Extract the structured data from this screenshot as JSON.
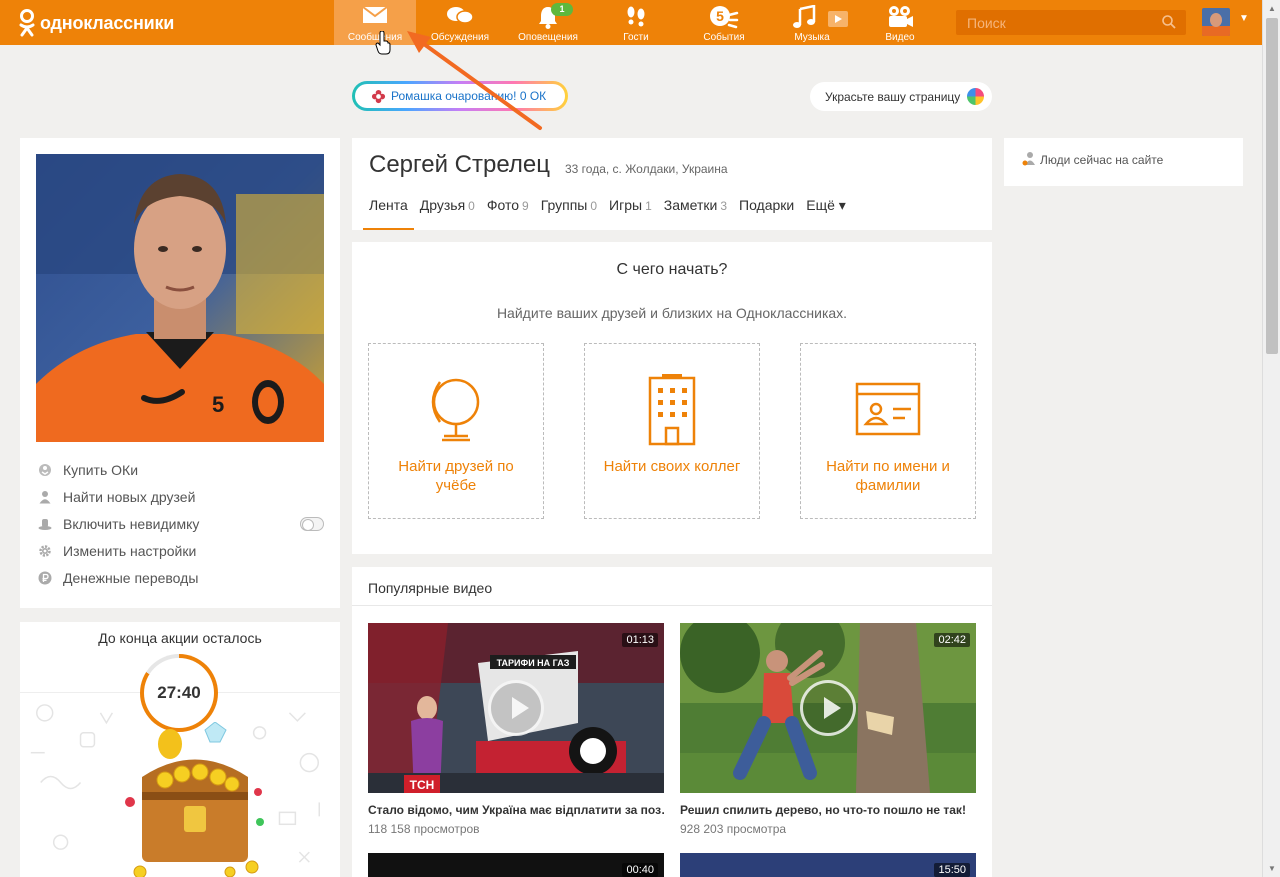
{
  "app": {
    "logo_text": "одноклассники",
    "brand_color": "#ee8208"
  },
  "nav": [
    {
      "label": "Сообщения",
      "icon": "envelope-icon",
      "badge": ""
    },
    {
      "label": "Обсуждения",
      "icon": "chat-bubbles-icon",
      "badge": ""
    },
    {
      "label": "Оповещения",
      "icon": "bell-icon",
      "badge": "1"
    },
    {
      "label": "Гости",
      "icon": "footprints-icon",
      "badge": ""
    },
    {
      "label": "События",
      "icon": "events-five-icon",
      "badge": ""
    },
    {
      "label": "Музыка",
      "icon": "music-note-icon",
      "badge": ""
    },
    {
      "label": "Видео",
      "icon": "video-camera-icon",
      "badge": ""
    }
  ],
  "search": {
    "placeholder": "Поиск"
  },
  "promo": {
    "text": "Ромашка очарованию! 0 ОК"
  },
  "decorate": {
    "text": "Украсьте вашу страницу"
  },
  "profile": {
    "name": "Сергей Стрелец",
    "meta": "33 года, с. Жолдаки, Украина"
  },
  "tabs": [
    {
      "label": "Лента",
      "count": ""
    },
    {
      "label": "Друзья",
      "count": "0"
    },
    {
      "label": "Фото",
      "count": "9"
    },
    {
      "label": "Группы",
      "count": "0"
    },
    {
      "label": "Игры",
      "count": "1"
    },
    {
      "label": "Заметки",
      "count": "3"
    },
    {
      "label": "Подарки",
      "count": ""
    },
    {
      "label": "Ещё ▾",
      "count": ""
    }
  ],
  "left_menu": [
    {
      "label": "Купить ОКи",
      "icon": "ok-coin-icon"
    },
    {
      "label": "Найти новых друзей",
      "icon": "person-icon"
    },
    {
      "label": "Включить невидимку",
      "icon": "hat-icon"
    },
    {
      "label": "Изменить настройки",
      "icon": "gear-icon"
    },
    {
      "label": "Денежные переводы",
      "icon": "ruble-icon"
    }
  ],
  "countdown": {
    "title": "До конца акции осталось",
    "time": "27:40"
  },
  "start": {
    "title": "С чего начать?",
    "subtitle": "Найдите ваших друзей и близких на Одноклассниках.",
    "options": [
      {
        "label": "Найти друзей по учёбе",
        "icon": "globe-icon"
      },
      {
        "label": "Найти своих коллег",
        "icon": "office-building-icon"
      },
      {
        "label": "Найти по имени и фамилии",
        "icon": "id-card-icon"
      }
    ]
  },
  "videos": {
    "title": "Популярные видео",
    "items": [
      {
        "title": "Стало відомо, чим Україна має відплатити за поз…",
        "views": "118 158 просмотров",
        "duration": "01:13"
      },
      {
        "title": "Решил спилить дерево, но что-то пошло не так!",
        "views": "928 203 просмотра",
        "duration": "02:42"
      },
      {
        "title": "",
        "views": "",
        "duration": "00:40"
      },
      {
        "title": "",
        "views": "",
        "duration": "15:50"
      }
    ]
  },
  "online": {
    "label": "Люди сейчас на сайте"
  }
}
